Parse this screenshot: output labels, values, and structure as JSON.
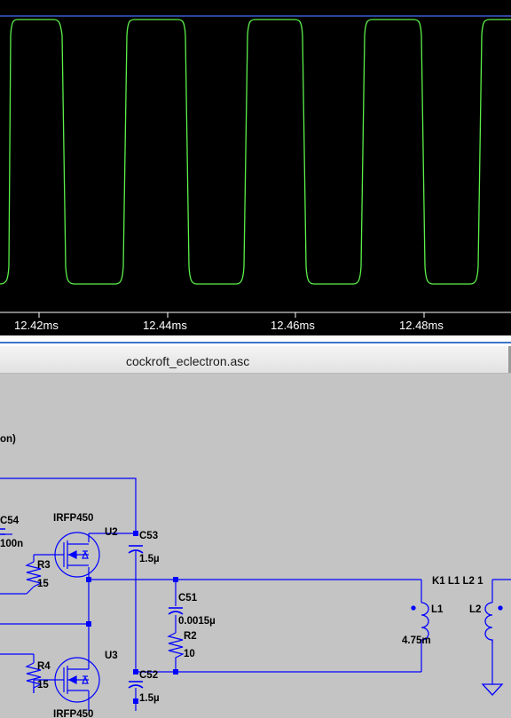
{
  "waveform": {
    "time_axis": [
      "12.42ms",
      "12.44ms",
      "12.46ms",
      "12.48ms"
    ],
    "trace_color": "#5cf04a",
    "background_color": "#000000"
  },
  "schematic_window": {
    "title": "cockroft_eclectron.asc",
    "background_color": "#c4c4c4",
    "wire_color": "#0000ff",
    "partial_text": "on)",
    "components": {
      "c54": {
        "name": "C54",
        "value": "100n"
      },
      "u2": {
        "name": "U2",
        "model": "IRFP450"
      },
      "r3": {
        "name": "R3",
        "value": "15"
      },
      "c53": {
        "name": "C53",
        "value": "1.5µ"
      },
      "c51": {
        "name": "C51",
        "value": "0.0015µ"
      },
      "r2": {
        "name": "R2",
        "value": "10"
      },
      "u3": {
        "name": "U3",
        "model": "IRFP450"
      },
      "r4": {
        "name": "R4",
        "value": "15"
      },
      "c52": {
        "name": "C52",
        "value": "1.5µ"
      },
      "l1": {
        "name": "L1",
        "value": "4.75m"
      },
      "l2": {
        "name": "L2"
      },
      "coupling": {
        "directive": "K1 L1 L2 1"
      }
    }
  }
}
